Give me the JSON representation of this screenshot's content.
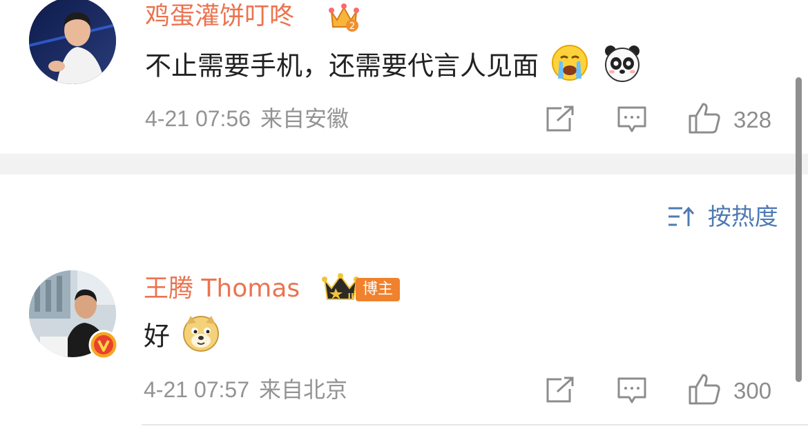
{
  "comments": [
    {
      "username": "鸡蛋灌饼叮咚",
      "text": "不止需要手机，还需要代言人见面",
      "date": "4-21 07:56",
      "location": "来自安徽",
      "likes": "328",
      "emojis": [
        "crying-emoji",
        "panda-emoji"
      ],
      "level_badge": "2"
    },
    {
      "username": "王腾 Thomas",
      "text": "好",
      "date": "4-21 07:57",
      "location": "来自北京",
      "likes": "300",
      "role_badge": "博主",
      "crown_level": "II",
      "emojis": [
        "doge-emoji"
      ]
    }
  ],
  "sort": {
    "label": "按热度"
  },
  "colors": {
    "username": "#eb7350",
    "link_blue": "#4f7ab3",
    "meta_gray": "#939393"
  }
}
